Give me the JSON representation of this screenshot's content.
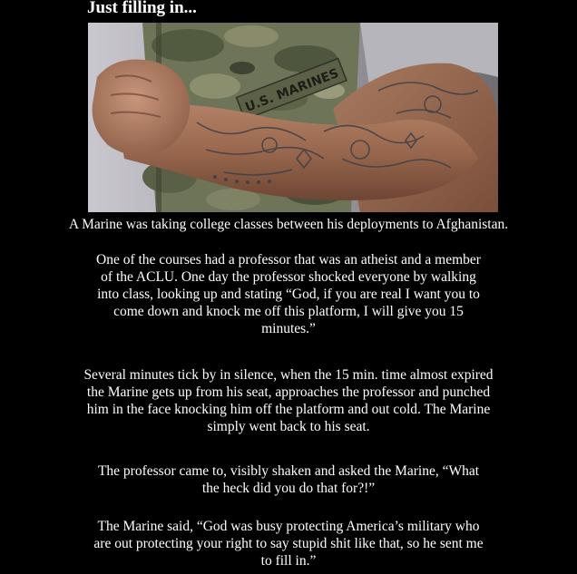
{
  "title": "Just filling in...",
  "photo": {
    "name_tape": "U.S. MARINES",
    "colors": {
      "camo_base": "#6e7458",
      "skin": "#9a6a50",
      "tattoo_ink": "#4a4a52"
    }
  },
  "story": {
    "p1": [
      "A Marine was taking college classes between his deployments to Afghanistan."
    ],
    "p2": [
      "One of the courses had a professor that was an atheist and a member",
      "of the ACLU. One day the professor shocked everyone by walking",
      "into class, looking up and stating “God, if you are real I want you to",
      "come down and knock me off this platform, I will give you 15",
      "minutes.”"
    ],
    "p3": [
      "Several minutes tick by in silence, when the 15 min. time almost expired",
      "the Marine gets up from his seat, approaches the professor and punched",
      "him in the face knocking him off the platform and out cold. The Marine",
      "simply went back to his seat."
    ],
    "p4": [
      "The professor came to, visibly shaken and asked the Marine, “What",
      "the heck did you do that for?!”"
    ],
    "p5": [
      "The Marine said, “God was busy protecting America’s military who",
      "are out protecting your right to say stupid shit like that, so he sent me",
      "to fill in.”"
    ]
  }
}
